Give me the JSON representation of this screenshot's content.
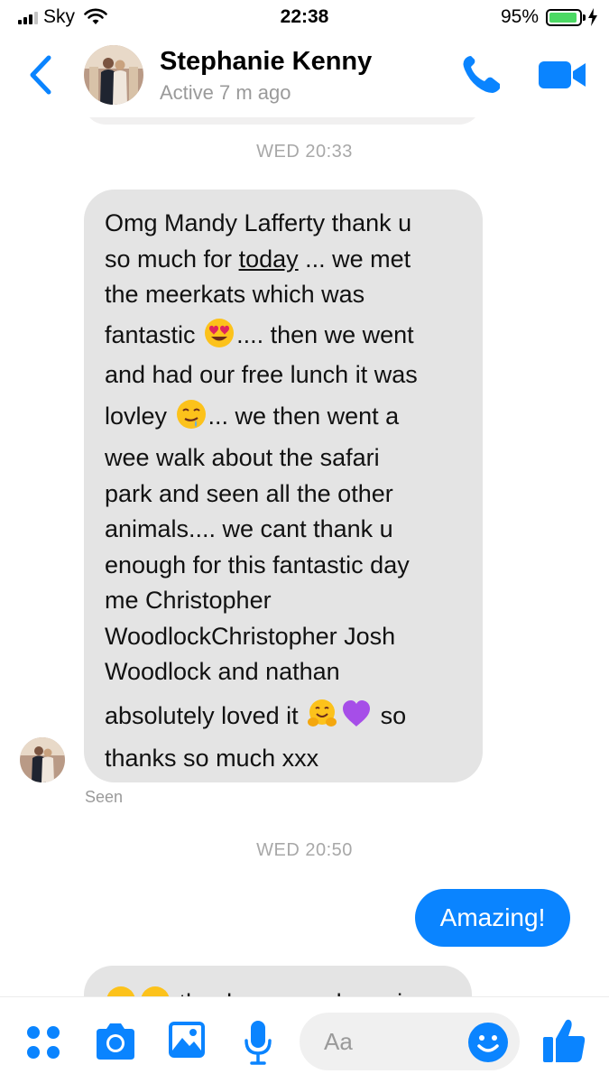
{
  "status_bar": {
    "carrier": "Sky",
    "time": "22:38",
    "battery_percent": "95%",
    "battery_level": 0.95,
    "signal_bars": 3
  },
  "header": {
    "contact_name": "Stephanie Kenny",
    "contact_status": "Active 7 m ago",
    "back_icon": "chevron-left-icon",
    "call_icon": "phone-icon",
    "video_icon": "video-camera-icon",
    "accent_color": "#0a84ff"
  },
  "conversation": {
    "timestamp_1": "WED 20:33",
    "incoming_message": {
      "lines": [
        {
          "text": "Omg Mandy Lafferty thank u"
        },
        {
          "pre": "so much for ",
          "underlined": "today",
          "post": " ... we met"
        },
        {
          "text": "the meerkats which was"
        },
        {
          "pre": "fantastic ",
          "emoji": "heart-eyes-emoji",
          "post": ".... then we went"
        },
        {
          "text": "and had our free lunch it was"
        },
        {
          "pre": "lovley ",
          "emoji": "drooling-face-emoji",
          "post": "... we then went a"
        },
        {
          "text": "wee walk about the safari"
        },
        {
          "text": "park and seen all the other"
        },
        {
          "text": "animals.... we cant thank u"
        },
        {
          "text": "enough for this fantastic day"
        },
        {
          "text": "me Christopher"
        },
        {
          "text": "WoodlockChristopher Josh"
        },
        {
          "text": "Woodlock and nathan"
        },
        {
          "pre": "absolutely loved it ",
          "emoji": "hugging-face-emoji",
          "emoji2": "purple-heart-emoji",
          "post": " so"
        },
        {
          "text": "thanks so much xxx"
        }
      ]
    },
    "seen_label": "Seen",
    "timestamp_2": "WED 20:50",
    "outgoing_message": "Amazing!",
    "next_message_partial": "thanks so much again"
  },
  "composer": {
    "placeholder": "Aa",
    "apps_icon": "four-dots-icon",
    "camera_icon": "camera-icon",
    "gallery_icon": "image-icon",
    "mic_icon": "microphone-icon",
    "emoji_icon": "smiley-icon",
    "like_icon": "thumbs-up-icon"
  }
}
